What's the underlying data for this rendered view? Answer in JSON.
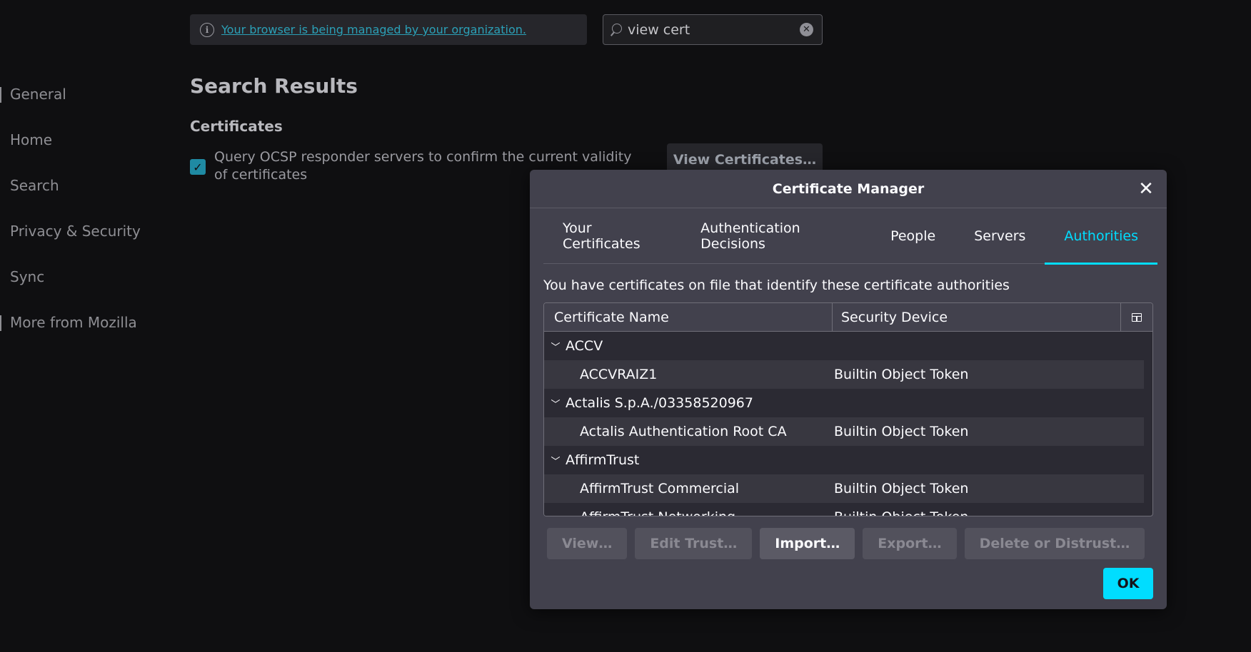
{
  "managed_bar": {
    "link_text": "Your browser is being managed by your organization."
  },
  "search": {
    "value": "view cert"
  },
  "sidebar": {
    "items": [
      {
        "label": "General"
      },
      {
        "label": "Home"
      },
      {
        "label": "Search"
      },
      {
        "label": "Privacy & Security"
      },
      {
        "label": "Sync"
      },
      {
        "label": "More from Mozilla"
      }
    ]
  },
  "results": {
    "title": "Search Results",
    "section": "Certificates",
    "ocsp_label": "Query OCSP responder servers to confirm the current validity of certificates",
    "view_certificates_button": "View Certificates…"
  },
  "dialog": {
    "title": "Certificate Manager",
    "tabs": [
      {
        "label": "Your Certificates"
      },
      {
        "label": "Authentication Decisions"
      },
      {
        "label": "People"
      },
      {
        "label": "Servers"
      },
      {
        "label": "Authorities"
      }
    ],
    "active_tab": "Authorities",
    "description": "You have certificates on file that identify these certificate authorities",
    "columns": {
      "name": "Certificate Name",
      "device": "Security Device"
    },
    "rows": [
      {
        "group": "ACCV",
        "name": "ACCVRAIZ1",
        "device": "Builtin Object Token"
      },
      {
        "group": "Actalis S.p.A./03358520967",
        "name": "Actalis Authentication Root CA",
        "device": "Builtin Object Token"
      },
      {
        "group": "AffirmTrust",
        "name": "AffirmTrust Commercial",
        "device": "Builtin Object Token"
      },
      {
        "name": "AffirmTrust Networking",
        "device": "Builtin Object Token"
      }
    ],
    "buttons": {
      "view": "View…",
      "edit_trust": "Edit Trust…",
      "import": "Import…",
      "export": "Export…",
      "delete": "Delete or Distrust…"
    },
    "ok": "OK"
  },
  "colors": {
    "accent": "#00ddff",
    "dialog_bg": "#42414d",
    "page_bg": "#0f0f11"
  }
}
